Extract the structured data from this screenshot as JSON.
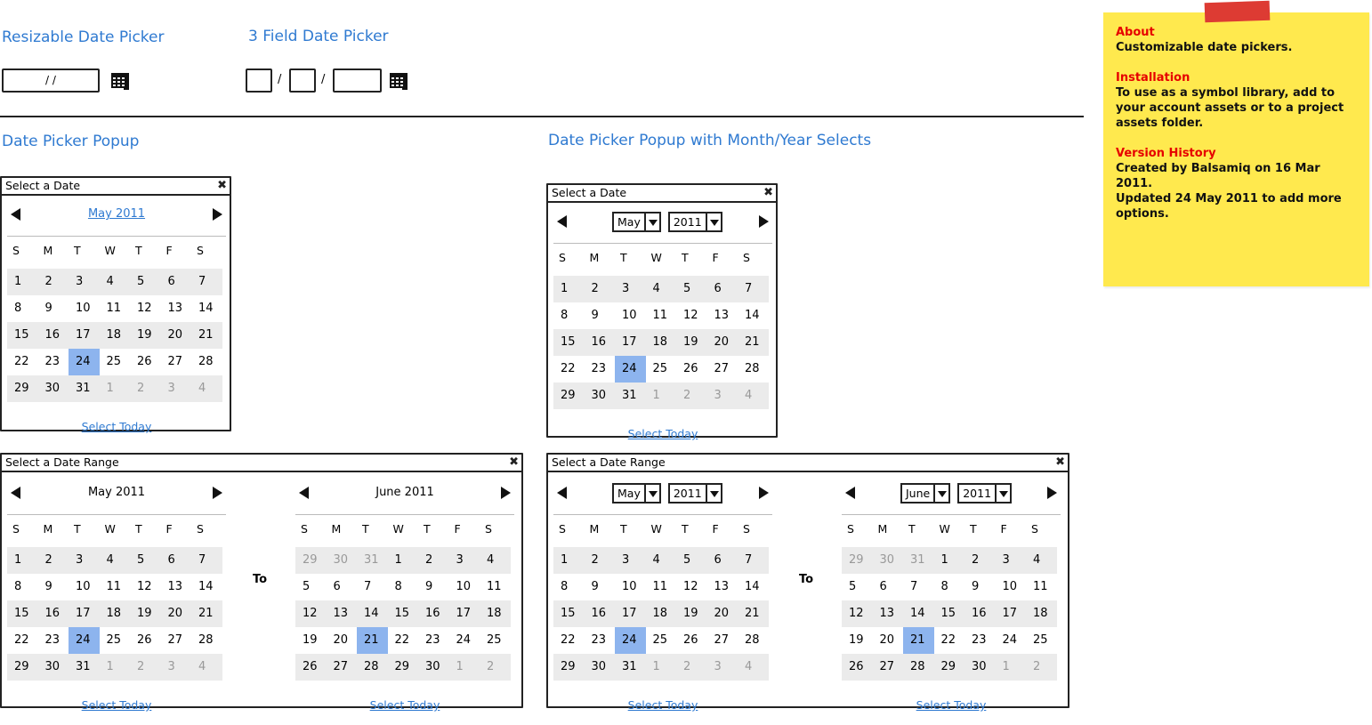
{
  "headings": {
    "resizable": "Resizable Date Picker",
    "three_field": "3 Field Date Picker",
    "popup": "Date Picker Popup",
    "popup_selects": "Date Picker Popup with Month/Year Selects"
  },
  "resizable_input": {
    "value": "/  /"
  },
  "three_field_input": {
    "sep1": "/",
    "sep2": "/"
  },
  "popups": {
    "single_title": "Select a Date",
    "range_title": "Select a Date Range",
    "close_icon": "✖",
    "to_label": "To",
    "select_today": "Select Today"
  },
  "dow": [
    "S",
    "M",
    "T",
    "W",
    "T",
    "F",
    "S"
  ],
  "may": {
    "title": "May 2011",
    "month_select": "May",
    "year_select": "2011",
    "weeks": [
      [
        "1",
        "2",
        "3",
        "4",
        "5",
        "6",
        "7"
      ],
      [
        "8",
        "9",
        "10",
        "11",
        "12",
        "13",
        "14"
      ],
      [
        "15",
        "16",
        "17",
        "18",
        "19",
        "20",
        "21"
      ],
      [
        "22",
        "23",
        "24",
        "25",
        "26",
        "27",
        "28"
      ],
      [
        "29",
        "30",
        "31",
        "1",
        "2",
        "3",
        "4"
      ]
    ],
    "dim": [
      [
        4,
        3
      ],
      [
        4,
        4
      ],
      [
        4,
        5
      ],
      [
        4,
        6
      ]
    ],
    "selected": [
      3,
      2
    ]
  },
  "june": {
    "title": "June 2011",
    "month_select": "June",
    "year_select": "2011",
    "weeks": [
      [
        "29",
        "30",
        "31",
        "1",
        "2",
        "3",
        "4"
      ],
      [
        "5",
        "6",
        "7",
        "8",
        "9",
        "10",
        "11"
      ],
      [
        "12",
        "13",
        "14",
        "15",
        "16",
        "17",
        "18"
      ],
      [
        "19",
        "20",
        "21",
        "22",
        "23",
        "24",
        "25"
      ],
      [
        "26",
        "27",
        "28",
        "29",
        "30",
        "1",
        "2"
      ]
    ],
    "dim": [
      [
        0,
        0
      ],
      [
        0,
        1
      ],
      [
        0,
        2
      ],
      [
        4,
        5
      ],
      [
        4,
        6
      ]
    ],
    "selected": [
      3,
      2
    ]
  },
  "sticky": {
    "about_h": "About",
    "about_b": "Customizable date pickers.",
    "install_h": "Installation",
    "install_b": "To use as a symbol library, add to your account assets or to a project assets folder.",
    "version_h": "Version History",
    "version_b1": "Created by Balsamiq on 16 Mar 2011.",
    "version_b2": "Updated 24 May 2011 to add more options."
  },
  "colors": {
    "link": "#2f7ad1",
    "selected_day": "#8db4ee",
    "stripe": "#ebebeb",
    "sticky": "#ffe94e",
    "sticky_heading": "#e60000"
  }
}
